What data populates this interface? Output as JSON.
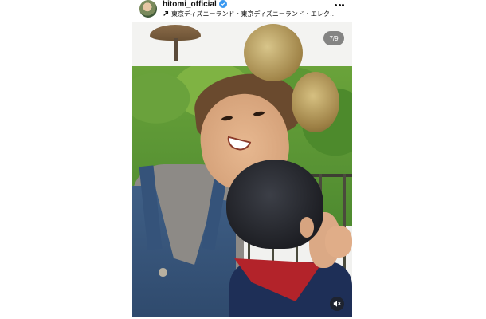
{
  "post": {
    "username": "hitomi_official",
    "location": "東京ディズニーランド・東京ディズニーランド・エレク…",
    "slide_counter": "7/9"
  },
  "icons": {
    "avatar": "profile-avatar",
    "verified": "verified-badge-icon",
    "location": "location-arrow-icon",
    "more": "more-options-icon",
    "mute": "mute-icon"
  },
  "colors": {
    "verified": "#3897f0",
    "text": "#111111",
    "counter_bg": "rgba(40,40,40,0.55)"
  }
}
